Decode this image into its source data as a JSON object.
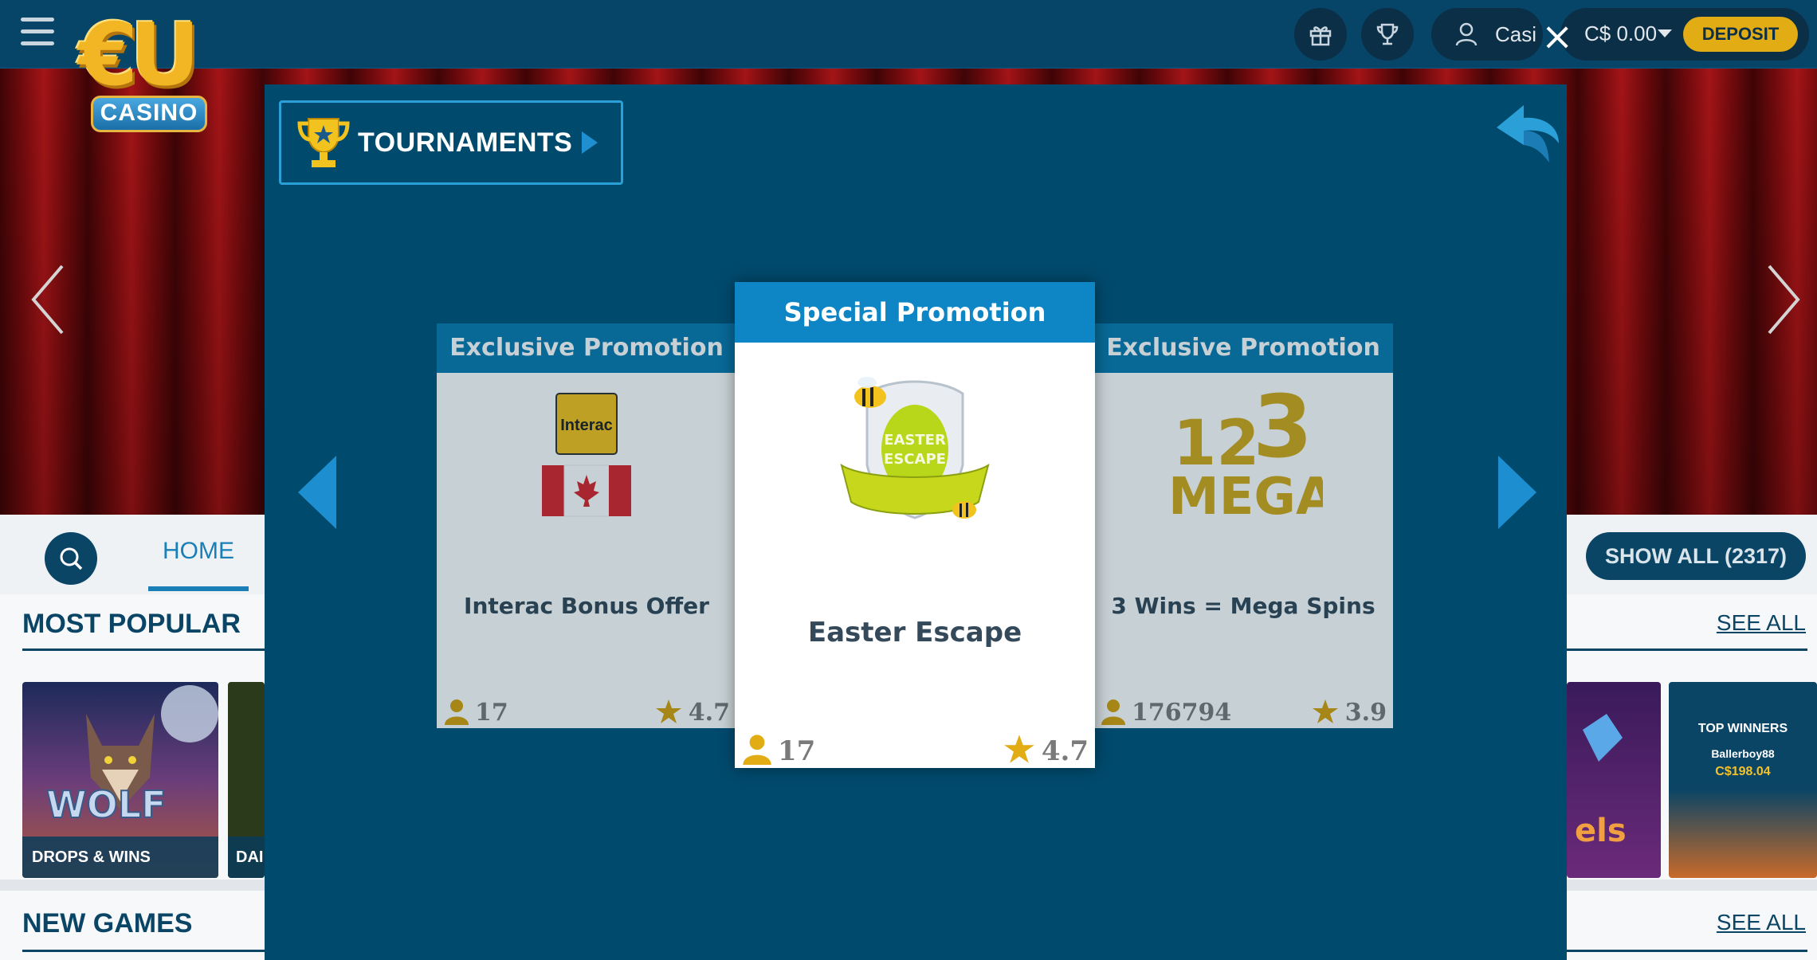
{
  "header": {
    "user_label": "Casi",
    "balance": "C$ 0.00",
    "deposit_label": "DEPOSIT",
    "logo_text": "€U",
    "logo_sub": "CASINO"
  },
  "nav": {
    "home_label": "HOME",
    "show_all_label": "SHOW ALL (2317)"
  },
  "sections": {
    "most_popular": "MOST POPULAR",
    "new_games": "NEW GAMES",
    "see_all": "SEE ALL"
  },
  "tiles": {
    "wolf_label": "DROPS & WINS",
    "second_label": "DAI",
    "top_winners_title": "TOP WINNERS",
    "top_winner_name": "Ballerboy88",
    "top_winner_amount": "C$198.04"
  },
  "modal": {
    "title": "TOURNAMENTS",
    "cards": [
      {
        "header": "Exclusive Promotion",
        "title": "Interac Bonus Offer",
        "players": "17",
        "rating": "4.7",
        "image": "interac-canada-logo"
      },
      {
        "header": "Special Promotion",
        "title": "Easter Escape",
        "players": "17",
        "rating": "4.7",
        "image": "easter-escape-badge"
      },
      {
        "header": "Exclusive Promotion",
        "title": "3 Wins = Mega Spins",
        "players": "176794",
        "rating": "3.9",
        "image": "123-mega-logo"
      }
    ]
  },
  "colors": {
    "modal_bg": "#004a6d",
    "accent": "#0e86c5",
    "gold": "#e2ac14"
  }
}
